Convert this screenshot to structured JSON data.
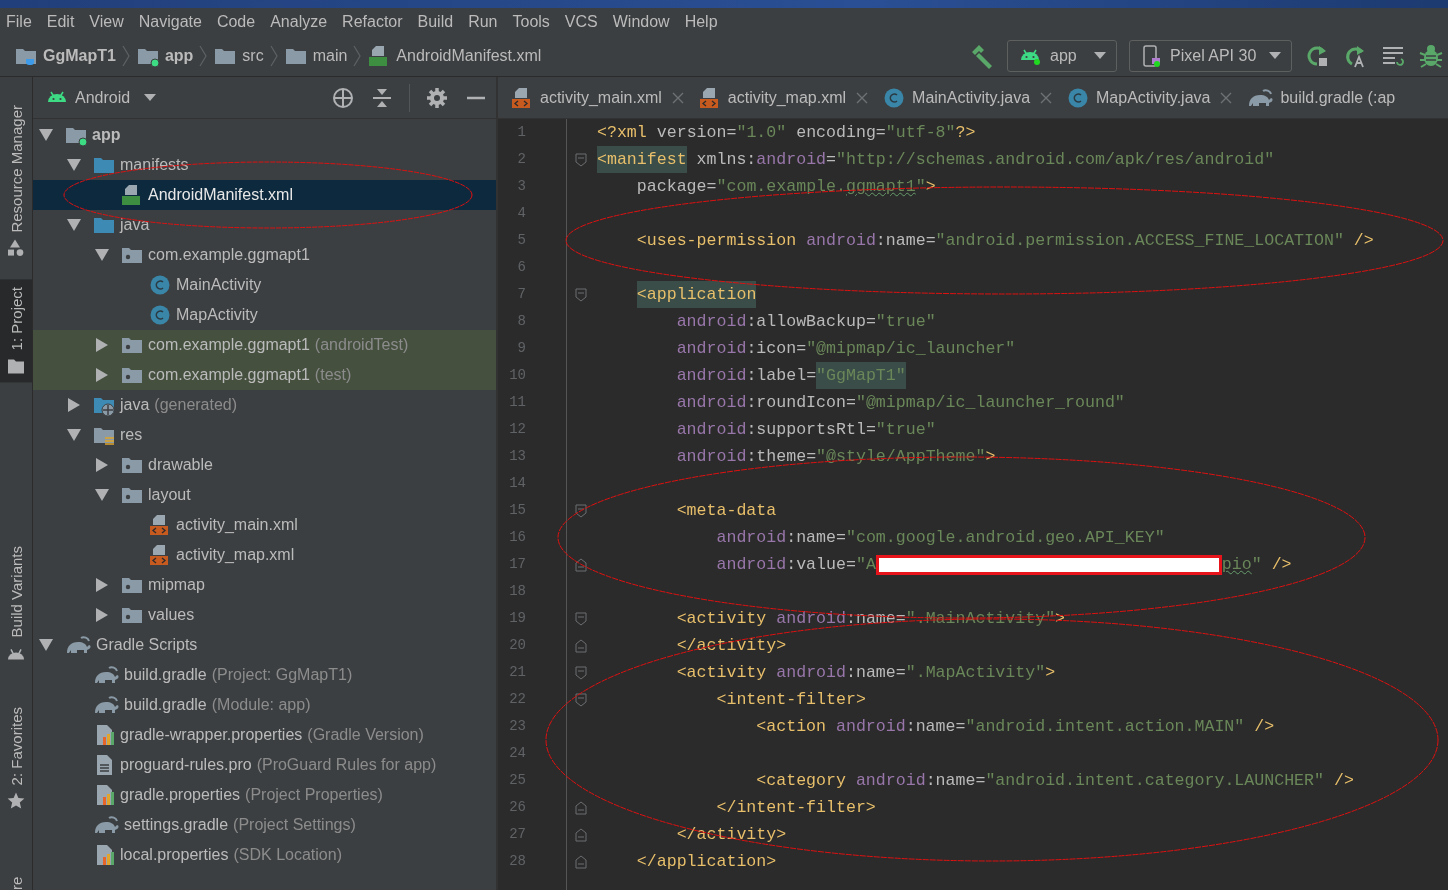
{
  "menu": [
    "File",
    "Edit",
    "View",
    "Navigate",
    "Code",
    "Analyze",
    "Refactor",
    "Build",
    "Run",
    "Tools",
    "VCS",
    "Window",
    "Help"
  ],
  "breadcrumbs": [
    {
      "label": "GgMapT1",
      "kind": "project"
    },
    {
      "label": "app",
      "kind": "module"
    },
    {
      "label": "src",
      "kind": "folder"
    },
    {
      "label": "main",
      "kind": "folder"
    },
    {
      "label": "AndroidManifest.xml",
      "kind": "manifest"
    }
  ],
  "toolbar": {
    "run_config": "app",
    "device": "Pixel API 30"
  },
  "tool_strip": [
    {
      "label": "Resource Manager",
      "kind": "resources",
      "selected": false
    },
    {
      "label": "1: Project",
      "kind": "project",
      "selected": true
    },
    {
      "label": "Build Variants",
      "kind": "variants",
      "selected": false
    },
    {
      "label": "2: Favorites",
      "kind": "favorites",
      "selected": false
    },
    {
      "label": "re",
      "kind": "cut",
      "selected": false
    }
  ],
  "project": {
    "view": "Android",
    "tree": [
      {
        "label": "app",
        "kind": "module",
        "expanded": true,
        "selected": false,
        "children": [
          {
            "label": "manifests",
            "kind": "source-folder",
            "expanded": true,
            "selected": false,
            "children": [
              {
                "label": "AndroidManifest.xml",
                "kind": "manifest",
                "selected": true,
                "circled": true
              }
            ]
          },
          {
            "label": "java",
            "kind": "source-folder",
            "expanded": true,
            "selected": false,
            "children": [
              {
                "label": "com.example.ggmapt1",
                "kind": "package",
                "expanded": true,
                "selected": false,
                "children": [
                  {
                    "label": "MainActivity",
                    "kind": "class",
                    "selected": false
                  },
                  {
                    "label": "MapActivity",
                    "kind": "class",
                    "selected": false
                  }
                ]
              },
              {
                "label": "com.example.ggmapt1",
                "hint": "(androidTest)",
                "kind": "package",
                "expanded": false,
                "selected": false,
                "test_source": true
              },
              {
                "label": "com.example.ggmapt1",
                "hint": "(test)",
                "kind": "package",
                "expanded": false,
                "selected": false,
                "test_source": true
              }
            ]
          },
          {
            "label": "java",
            "hint": "(generated)",
            "kind": "generated",
            "expanded": false,
            "selected": false
          },
          {
            "label": "res",
            "kind": "res",
            "expanded": true,
            "selected": false,
            "children": [
              {
                "label": "drawable",
                "kind": "package",
                "expanded": false,
                "selected": false
              },
              {
                "label": "layout",
                "kind": "package",
                "expanded": true,
                "selected": false,
                "children": [
                  {
                    "label": "activity_main.xml",
                    "kind": "xml",
                    "selected": false
                  },
                  {
                    "label": "activity_map.xml",
                    "kind": "xml",
                    "selected": false
                  }
                ]
              },
              {
                "label": "mipmap",
                "kind": "package",
                "expanded": false,
                "selected": false
              },
              {
                "label": "values",
                "kind": "package",
                "expanded": false,
                "selected": false
              }
            ]
          }
        ]
      },
      {
        "label": "Gradle Scripts",
        "kind": "gradle",
        "expanded": true,
        "selected": false,
        "children": [
          {
            "label": "build.gradle",
            "hint": "(Project: GgMapT1)",
            "kind": "gradle",
            "selected": false
          },
          {
            "label": "build.gradle",
            "hint": "(Module: app)",
            "kind": "gradle",
            "selected": false
          },
          {
            "label": "gradle-wrapper.properties",
            "hint": "(Gradle Version)",
            "kind": "properties",
            "selected": false
          },
          {
            "label": "proguard-rules.pro",
            "hint": "(ProGuard Rules for app)",
            "kind": "text",
            "selected": false
          },
          {
            "label": "gradle.properties",
            "hint": "(Project Properties)",
            "kind": "properties",
            "selected": false
          },
          {
            "label": "settings.gradle",
            "hint": "(Project Settings)",
            "kind": "gradle",
            "selected": false
          },
          {
            "label": "local.properties",
            "hint": "(SDK Location)",
            "kind": "properties",
            "selected": false
          }
        ]
      }
    ]
  },
  "editor": {
    "tabs": [
      {
        "label": "activity_main.xml",
        "kind": "xml",
        "selected": false
      },
      {
        "label": "activity_map.xml",
        "kind": "xml",
        "selected": false
      },
      {
        "label": "MainActivity.java",
        "kind": "class",
        "selected": false
      },
      {
        "label": "MapActivity.java",
        "kind": "class",
        "selected": false
      },
      {
        "label": "build.gradle (:ap",
        "kind": "gradle",
        "selected": false
      }
    ],
    "lines": [
      {
        "n": "1",
        "tokens": [
          {
            "kind": "tag",
            "text": "<?xml"
          },
          {
            "kind": "attr",
            "text": " version"
          },
          {
            "kind": "punct",
            "text": "="
          },
          {
            "kind": "val",
            "text": "\"1.0\""
          },
          {
            "kind": "attr",
            "text": " encoding"
          },
          {
            "kind": "punct",
            "text": "="
          },
          {
            "kind": "val",
            "text": "\"utf-8\""
          },
          {
            "kind": "tag",
            "text": "?>"
          }
        ]
      },
      {
        "n": "2",
        "fold_open": true,
        "tokens": [
          {
            "kind": "tag",
            "text": "<manifest",
            "hl": true
          },
          {
            "kind": "attr",
            "text": " xmlns:"
          },
          {
            "kind": "ns",
            "text": "android"
          },
          {
            "kind": "punct",
            "text": "="
          },
          {
            "kind": "val",
            "text": "\"http://schemas.android.com/apk/res/android\""
          }
        ]
      },
      {
        "n": "3",
        "tokens": [
          {
            "kind": "attr",
            "text": "    package"
          },
          {
            "kind": "punct",
            "text": "="
          },
          {
            "kind": "val",
            "text": "\"com.example."
          },
          {
            "kind": "val",
            "text": "ggmapt1",
            "typo": true
          },
          {
            "kind": "val",
            "text": "\""
          },
          {
            "kind": "tag",
            "text": ">"
          }
        ]
      },
      {
        "n": "4",
        "circle_start": true
      },
      {
        "n": "5",
        "tokens": [
          {
            "kind": "tag",
            "text": "    <uses-permission"
          },
          {
            "kind": "ns",
            "text": " android"
          },
          {
            "kind": "attr",
            "text": ":name"
          },
          {
            "kind": "punct",
            "text": "="
          },
          {
            "kind": "val",
            "text": "\"android.permission.ACCESS_FINE_LOCATION\""
          },
          {
            "kind": "tag",
            "text": " />"
          }
        ]
      },
      {
        "n": "6",
        "circle_end": true
      },
      {
        "n": "7",
        "fold_open": true,
        "tokens": [
          {
            "kind": "tag",
            "text": "    <application",
            "hl": true
          }
        ]
      },
      {
        "n": "8",
        "tokens": [
          {
            "kind": "ns",
            "text": "        android"
          },
          {
            "kind": "attr",
            "text": ":allowBackup"
          },
          {
            "kind": "punct",
            "text": "="
          },
          {
            "kind": "val",
            "text": "\"true\""
          }
        ]
      },
      {
        "n": "9",
        "tokens": [
          {
            "kind": "ns",
            "text": "        android"
          },
          {
            "kind": "attr",
            "text": ":icon"
          },
          {
            "kind": "punct",
            "text": "="
          },
          {
            "kind": "val",
            "text": "\"@mipmap/ic_launcher\""
          }
        ]
      },
      {
        "n": "10",
        "tokens": [
          {
            "kind": "ns",
            "text": "        android"
          },
          {
            "kind": "attr",
            "text": ":label"
          },
          {
            "kind": "punct",
            "text": "="
          },
          {
            "kind": "val",
            "text": "\"GgMapT1\"",
            "hl": true
          }
        ]
      },
      {
        "n": "11",
        "tokens": [
          {
            "kind": "ns",
            "text": "        android"
          },
          {
            "kind": "attr",
            "text": ":roundIcon"
          },
          {
            "kind": "punct",
            "text": "="
          },
          {
            "kind": "val",
            "text": "\"@mipmap/ic_launcher_round\""
          }
        ]
      },
      {
        "n": "12",
        "tokens": [
          {
            "kind": "ns",
            "text": "        android"
          },
          {
            "kind": "attr",
            "text": ":supportsRtl"
          },
          {
            "kind": "punct",
            "text": "="
          },
          {
            "kind": "val",
            "text": "\"true\""
          }
        ]
      },
      {
        "n": "13",
        "tokens": [
          {
            "kind": "ns",
            "text": "        android"
          },
          {
            "kind": "attr",
            "text": ":theme"
          },
          {
            "kind": "punct",
            "text": "="
          },
          {
            "kind": "val",
            "text": "\"@style/AppTheme\""
          },
          {
            "kind": "tag",
            "text": ">"
          }
        ]
      },
      {
        "n": "14",
        "circle_start": true
      },
      {
        "n": "15",
        "fold_open": true,
        "tokens": [
          {
            "kind": "tag",
            "text": "        <meta-data"
          }
        ]
      },
      {
        "n": "16",
        "tokens": [
          {
            "kind": "ns",
            "text": "            android"
          },
          {
            "kind": "attr",
            "text": ":name"
          },
          {
            "kind": "punct",
            "text": "="
          },
          {
            "kind": "val",
            "text": "\"com.google.android.geo.API_KEY\""
          }
        ]
      },
      {
        "n": "17",
        "fold_close": true,
        "tokens": [
          {
            "kind": "ns",
            "text": "            android"
          },
          {
            "kind": "attr",
            "text": ":value"
          },
          {
            "kind": "punct",
            "text": "="
          },
          {
            "kind": "val",
            "text": "\"A"
          },
          {
            "kind": "redaction"
          },
          {
            "kind": "val",
            "text": "pio",
            "typo": true
          },
          {
            "kind": "val",
            "text": "\""
          },
          {
            "kind": "tag",
            "text": " />"
          }
        ]
      },
      {
        "n": "18",
        "circle_end": true
      },
      {
        "n": "19",
        "fold_open": true,
        "tokens": [
          {
            "kind": "tag",
            "text": "        <activity"
          },
          {
            "kind": "ns",
            "text": " android"
          },
          {
            "kind": "attr",
            "text": ":name"
          },
          {
            "kind": "punct",
            "text": "="
          },
          {
            "kind": "val",
            "text": "\".MainActivity\""
          },
          {
            "kind": "tag",
            "text": ">"
          }
        ]
      },
      {
        "n": "20",
        "circle_start": true,
        "fold_close": true,
        "tokens": [
          {
            "kind": "tag",
            "text": "        </activity>"
          }
        ]
      },
      {
        "n": "21",
        "fold_open": true,
        "tokens": [
          {
            "kind": "tag",
            "text": "        <activity"
          },
          {
            "kind": "ns",
            "text": " android"
          },
          {
            "kind": "attr",
            "text": ":name"
          },
          {
            "kind": "punct",
            "text": "="
          },
          {
            "kind": "val",
            "text": "\".MapActivity\""
          },
          {
            "kind": "tag",
            "text": ">"
          }
        ]
      },
      {
        "n": "22",
        "fold_open": true,
        "tokens": [
          {
            "kind": "tag",
            "text": "            <intent-filter>"
          }
        ]
      },
      {
        "n": "23",
        "tokens": [
          {
            "kind": "tag",
            "text": "                <action"
          },
          {
            "kind": "ns",
            "text": " android"
          },
          {
            "kind": "attr",
            "text": ":name"
          },
          {
            "kind": "punct",
            "text": "="
          },
          {
            "kind": "val",
            "text": "\"android.intent.action.MAIN\""
          },
          {
            "kind": "tag",
            "text": " />"
          }
        ]
      },
      {
        "n": "24"
      },
      {
        "n": "25",
        "tokens": [
          {
            "kind": "tag",
            "text": "                <category"
          },
          {
            "kind": "ns",
            "text": " android"
          },
          {
            "kind": "attr",
            "text": ":name"
          },
          {
            "kind": "punct",
            "text": "="
          },
          {
            "kind": "val",
            "text": "\"android.intent.category.LAUNCHER\""
          },
          {
            "kind": "tag",
            "text": " />"
          }
        ]
      },
      {
        "n": "26",
        "fold_close": true,
        "tokens": [
          {
            "kind": "tag",
            "text": "            </intent-filter>"
          }
        ]
      },
      {
        "n": "27",
        "circle_end": true,
        "fold_close": true,
        "tokens": [
          {
            "kind": "tag",
            "text": "        </activity>"
          }
        ]
      },
      {
        "n": "28",
        "fold_close": true,
        "tokens": [
          {
            "kind": "tag",
            "text": "    </application>"
          }
        ]
      }
    ]
  }
}
